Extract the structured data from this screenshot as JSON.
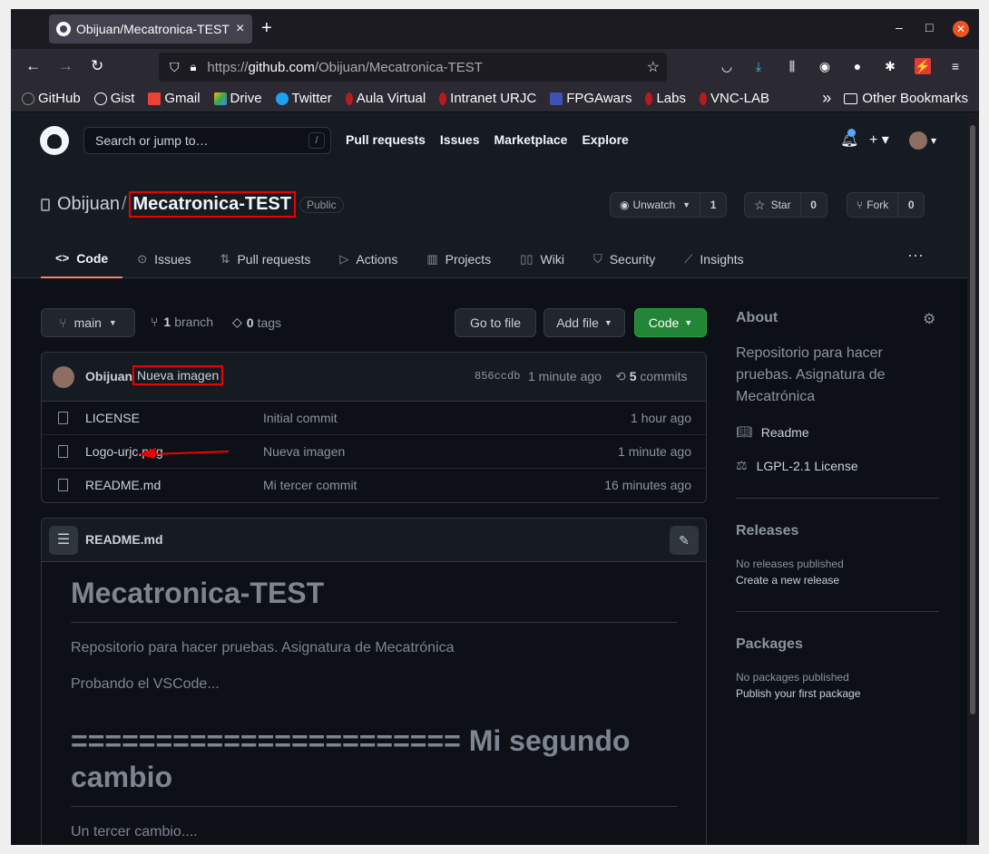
{
  "browser": {
    "tab_title": "Obijuan/Mecatronica-TEST",
    "tab_close": "×",
    "new_tab": "+",
    "url_prefix": "https://",
    "url_host": "github.com",
    "url_path": "/Obijuan/Mecatronica-TEST",
    "bookmarks": [
      {
        "label": "GitHub",
        "color": "#24292f"
      },
      {
        "label": "Gist",
        "color": "#fbfbfe"
      },
      {
        "label": "Gmail",
        "color": "#ea4335"
      },
      {
        "label": "Drive",
        "color": "#fbbc04"
      },
      {
        "label": "Twitter",
        "color": "#1da1f2"
      },
      {
        "label": "Aula Virtual",
        "color": "#b71c1c"
      },
      {
        "label": "Intranet URJC",
        "color": "#b71c1c"
      },
      {
        "label": "FPGAwars",
        "color": "#3f51b5"
      },
      {
        "label": "Labs",
        "color": "#b71c1c"
      },
      {
        "label": "VNC-LAB",
        "color": "#b71c1c"
      }
    ],
    "other_bookmarks": "Other Bookmarks",
    "more": "»"
  },
  "github": {
    "search_placeholder": "Search or jump to…",
    "search_key": "/",
    "nav": [
      "Pull requests",
      "Issues",
      "Marketplace",
      "Explore"
    ],
    "plus": "+ ▾",
    "avatar_caret": "▾"
  },
  "repo": {
    "owner": "Obijuan",
    "sep": "/",
    "name": "Mecatronica-TEST",
    "visibility": "Public",
    "unwatch": "Unwatch",
    "unwatch_count": "1",
    "star": "Star",
    "star_count": "0",
    "fork": "Fork",
    "fork_count": "0",
    "tabs": [
      {
        "label": "Code",
        "icon": "<>"
      },
      {
        "label": "Issues",
        "icon": "⊙"
      },
      {
        "label": "Pull requests",
        "icon": "⇅"
      },
      {
        "label": "Actions",
        "icon": "▷"
      },
      {
        "label": "Projects",
        "icon": "▥"
      },
      {
        "label": "Wiki",
        "icon": "▯▯"
      },
      {
        "label": "Security",
        "icon": "⛉"
      },
      {
        "label": "Insights",
        "icon": "⟋"
      }
    ],
    "more": "···"
  },
  "toolbar": {
    "branch": "main",
    "branch_count": "1",
    "branch_label": "branch",
    "tag_count": "0",
    "tag_label": "tags",
    "go_to_file": "Go to file",
    "add_file": "Add file",
    "code": "Code"
  },
  "commit": {
    "author": "Obijuan",
    "message": "Nueva imagen",
    "sha": "856ccdb",
    "time": "1 minute ago",
    "count": "5",
    "count_label": "commits"
  },
  "files": [
    {
      "name": "LICENSE",
      "message": "Initial commit",
      "time": "1 hour ago"
    },
    {
      "name": "Logo-urjc.png",
      "message": "Nueva imagen",
      "time": "1 minute ago"
    },
    {
      "name": "README.md",
      "message": "Mi tercer commit",
      "time": "16 minutes ago"
    }
  ],
  "readme": {
    "title": "README.md",
    "h1": "Mecatronica-TEST",
    "p1": "Repositorio para hacer pruebas. Asignatura de Mecatrónica",
    "p2": "Probando el VSCode...",
    "h1b": "======================= Mi segundo cambio",
    "p3": "Un tercer cambio...."
  },
  "about": {
    "title": "About",
    "description": "Repositorio para hacer pruebas. Asignatura de Mecatrónica",
    "readme": "Readme",
    "license": "LGPL-2.1 License",
    "releases_title": "Releases",
    "releases_none": "No releases published",
    "releases_create": "Create a new release",
    "packages_title": "Packages",
    "packages_none": "No packages published",
    "packages_publish": "Publish your first package"
  }
}
